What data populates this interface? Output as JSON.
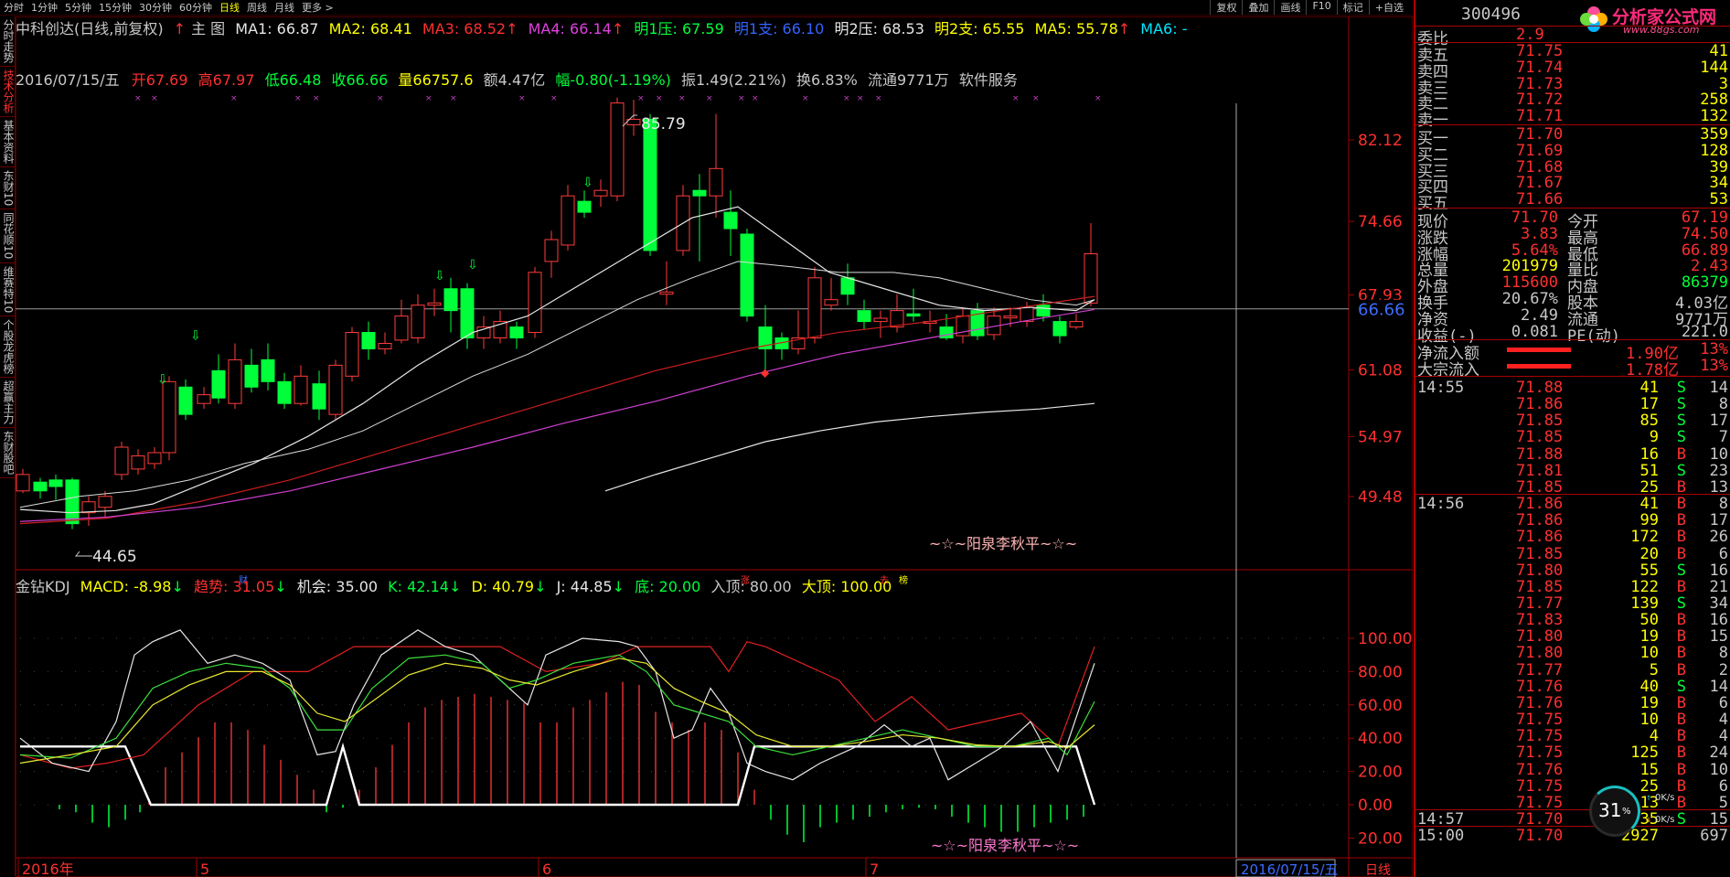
{
  "toolbar": {
    "tabs": [
      "分时",
      "1分钟",
      "5分钟",
      "15分钟",
      "30分钟",
      "60分钟",
      "日线",
      "周线",
      "月线",
      "更多 >"
    ],
    "right_tabs": [
      "复权",
      "叠加",
      "画线",
      "F10",
      "标记",
      "+自选"
    ]
  },
  "left_tabs": [
    "分时走势",
    "技术分析",
    "基本资料",
    "东财10",
    "同花顺10",
    "维赛特10",
    "个股龙虎榜",
    "超赢主力",
    "东财股吧"
  ],
  "header": {
    "stock_name": "中科创达(日线,前复权)",
    "main_label": "主 图",
    "ma1": "MA1: 66.87",
    "ma2": "MA2: 68.41",
    "ma3": "MA3: 68.52",
    "ma4": "MA4: 66.14",
    "ming1ya": "明1压: 67.59",
    "ming1zhi": "明1支: 66.10",
    "ming2ya": "明2压: 68.53",
    "ming2zhi": "明2支: 65.55",
    "ma5": "MA5: 55.78",
    "ma6": "MA6: -"
  },
  "quote_line": {
    "date": "2016/07/15/五",
    "open_label": "开",
    "open": "67.69",
    "high_label": "高",
    "high": "67.97",
    "low_label": "低",
    "low": "66.48",
    "close_label": "收",
    "close": "66.66",
    "vol": "量66757.6",
    "amount": "额4.47亿",
    "change": "幅-0.80(-1.19%)",
    "amplitude": "振1.49(2.21%)",
    "turnover": "换6.83%",
    "float": "流通9771万",
    "sector": "软件服务"
  },
  "price_axis": [
    "82.12",
    "74.66",
    "67.93",
    "61.08",
    "54.97",
    "49.48"
  ],
  "current_price_tag": "66.66",
  "peak_label": "85.79",
  "low_label_text": "44.65",
  "watermark": "~☆~阳泉李秋平~☆~",
  "event_tags": [
    "财",
    "涨",
    "去",
    "榜"
  ],
  "indicator": {
    "name": "金钻KDJ",
    "macd": "MACD: -8.98",
    "trend": "趋势: 31.05",
    "chance": "机会: 35.00",
    "k": "K: 42.14",
    "d": "D: 40.79",
    "j": "J: 44.85",
    "bottom": "底: 20.00",
    "entry_top": "入顶: 80.00",
    "top": "大顶: 100.00",
    "axis": [
      "100.00",
      "80.00",
      "60.00",
      "40.00",
      "20.00",
      "0.00",
      "20.00"
    ]
  },
  "time_axis": [
    "2016年",
    "5",
    "6",
    "7",
    "2016/07/15/五",
    "日线"
  ],
  "right_panel": {
    "code": "300496",
    "logo_text": "分析家公式网",
    "logo_url": "www.88gs.com",
    "weibi_label": "委比",
    "weibi_value": "2.9",
    "asks": [
      {
        "label": "卖五",
        "price": "71.75",
        "vol": "41"
      },
      {
        "label": "卖四",
        "price": "71.74",
        "vol": "144"
      },
      {
        "label": "卖三",
        "price": "71.73",
        "vol": "3"
      },
      {
        "label": "卖二",
        "price": "71.72",
        "vol": "258"
      },
      {
        "label": "卖一",
        "price": "71.71",
        "vol": "132"
      }
    ],
    "bids": [
      {
        "label": "买一",
        "price": "71.70",
        "vol": "359"
      },
      {
        "label": "买二",
        "price": "71.69",
        "vol": "128"
      },
      {
        "label": "买三",
        "price": "71.68",
        "vol": "39"
      },
      {
        "label": "买四",
        "price": "71.67",
        "vol": "34"
      },
      {
        "label": "买五",
        "price": "71.66",
        "vol": "53"
      }
    ],
    "stats": [
      {
        "l1": "现价",
        "v1": "71.70",
        "l2": "今开",
        "v2": "67.19"
      },
      {
        "l1": "涨跌",
        "v1": "3.83",
        "l2": "最高",
        "v2": "74.50"
      },
      {
        "l1": "涨幅",
        "v1": "5.64%",
        "l2": "最低",
        "v2": "66.89"
      },
      {
        "l1": "总量",
        "v1": "201979",
        "l2": "量比",
        "v2": "2.43"
      },
      {
        "l1": "外盘",
        "v1": "115600",
        "l2": "内盘",
        "v2": "86379"
      },
      {
        "l1": "换手",
        "v1": "20.67%",
        "l2": "股本",
        "v2": "4.03亿"
      },
      {
        "l1": "净资",
        "v1": "2.49",
        "l2": "流通",
        "v2": "9771万"
      },
      {
        "l1": "收益(-)",
        "v1": "0.081",
        "l2": "PE(动)",
        "v2": "221.0"
      }
    ],
    "flows": [
      {
        "label": "净流入额",
        "value": "1.90亿",
        "pct": "13%"
      },
      {
        "label": "大宗流入",
        "value": "1.78亿",
        "pct": "13%"
      }
    ],
    "ticks": [
      {
        "time": "14:55",
        "price": "71.88",
        "vol": "41",
        "side": "S",
        "n": "14"
      },
      {
        "time": "",
        "price": "71.86",
        "vol": "17",
        "side": "S",
        "n": "8"
      },
      {
        "time": "",
        "price": "71.85",
        "vol": "85",
        "side": "S",
        "n": "17"
      },
      {
        "time": "",
        "price": "71.85",
        "vol": "9",
        "side": "S",
        "n": "7"
      },
      {
        "time": "",
        "price": "71.88",
        "vol": "16",
        "side": "B",
        "n": "10"
      },
      {
        "time": "",
        "price": "71.81",
        "vol": "51",
        "side": "S",
        "n": "23"
      },
      {
        "time": "",
        "price": "71.85",
        "vol": "25",
        "side": "B",
        "n": "13"
      },
      {
        "time": "14:56",
        "price": "71.86",
        "vol": "41",
        "side": "B",
        "n": "8"
      },
      {
        "time": "",
        "price": "71.86",
        "vol": "99",
        "side": "B",
        "n": "17"
      },
      {
        "time": "",
        "price": "71.86",
        "vol": "172",
        "side": "B",
        "n": "26"
      },
      {
        "time": "",
        "price": "71.85",
        "vol": "20",
        "side": "B",
        "n": "6"
      },
      {
        "time": "",
        "price": "71.80",
        "vol": "55",
        "side": "S",
        "n": "16"
      },
      {
        "time": "",
        "price": "71.85",
        "vol": "122",
        "side": "B",
        "n": "21"
      },
      {
        "time": "",
        "price": "71.77",
        "vol": "139",
        "side": "S",
        "n": "34"
      },
      {
        "time": "",
        "price": "71.83",
        "vol": "50",
        "side": "B",
        "n": "16"
      },
      {
        "time": "",
        "price": "71.80",
        "vol": "19",
        "side": "B",
        "n": "15"
      },
      {
        "time": "",
        "price": "71.80",
        "vol": "10",
        "side": "B",
        "n": "8"
      },
      {
        "time": "",
        "price": "71.77",
        "vol": "5",
        "side": "B",
        "n": "2"
      },
      {
        "time": "",
        "price": "71.76",
        "vol": "40",
        "side": "S",
        "n": "14"
      },
      {
        "time": "",
        "price": "71.76",
        "vol": "19",
        "side": "B",
        "n": "6"
      },
      {
        "time": "",
        "price": "71.75",
        "vol": "10",
        "side": "B",
        "n": "4"
      },
      {
        "time": "",
        "price": "71.75",
        "vol": "4",
        "side": "B",
        "n": "4"
      },
      {
        "time": "",
        "price": "71.75",
        "vol": "125",
        "side": "B",
        "n": "24"
      },
      {
        "time": "",
        "price": "71.76",
        "vol": "15",
        "side": "B",
        "n": "10"
      },
      {
        "time": "",
        "price": "71.75",
        "vol": "25",
        "side": "B",
        "n": "6"
      },
      {
        "time": "",
        "price": "71.75",
        "vol": "13",
        "side": "B",
        "n": "5"
      },
      {
        "time": "14:57",
        "price": "71.70",
        "vol": "35",
        "side": "S",
        "n": "15"
      },
      {
        "time": "15:00",
        "price": "71.70",
        "vol": "2927",
        "side": "",
        "n": "697"
      }
    ],
    "speed_pct": "31",
    "speed_unit": "%",
    "net_up": "0K/s",
    "net_down": "0K/s"
  },
  "colors": {
    "up": "#ff3c3c",
    "down": "#00ff3a",
    "ma_white": "#e6e6e6",
    "ma_red": "#c81e1e",
    "ma_magenta": "#d040d0",
    "yellow": "#ffff00",
    "blue_tag": "#3264ff",
    "cyan": "#00e6ff"
  }
}
